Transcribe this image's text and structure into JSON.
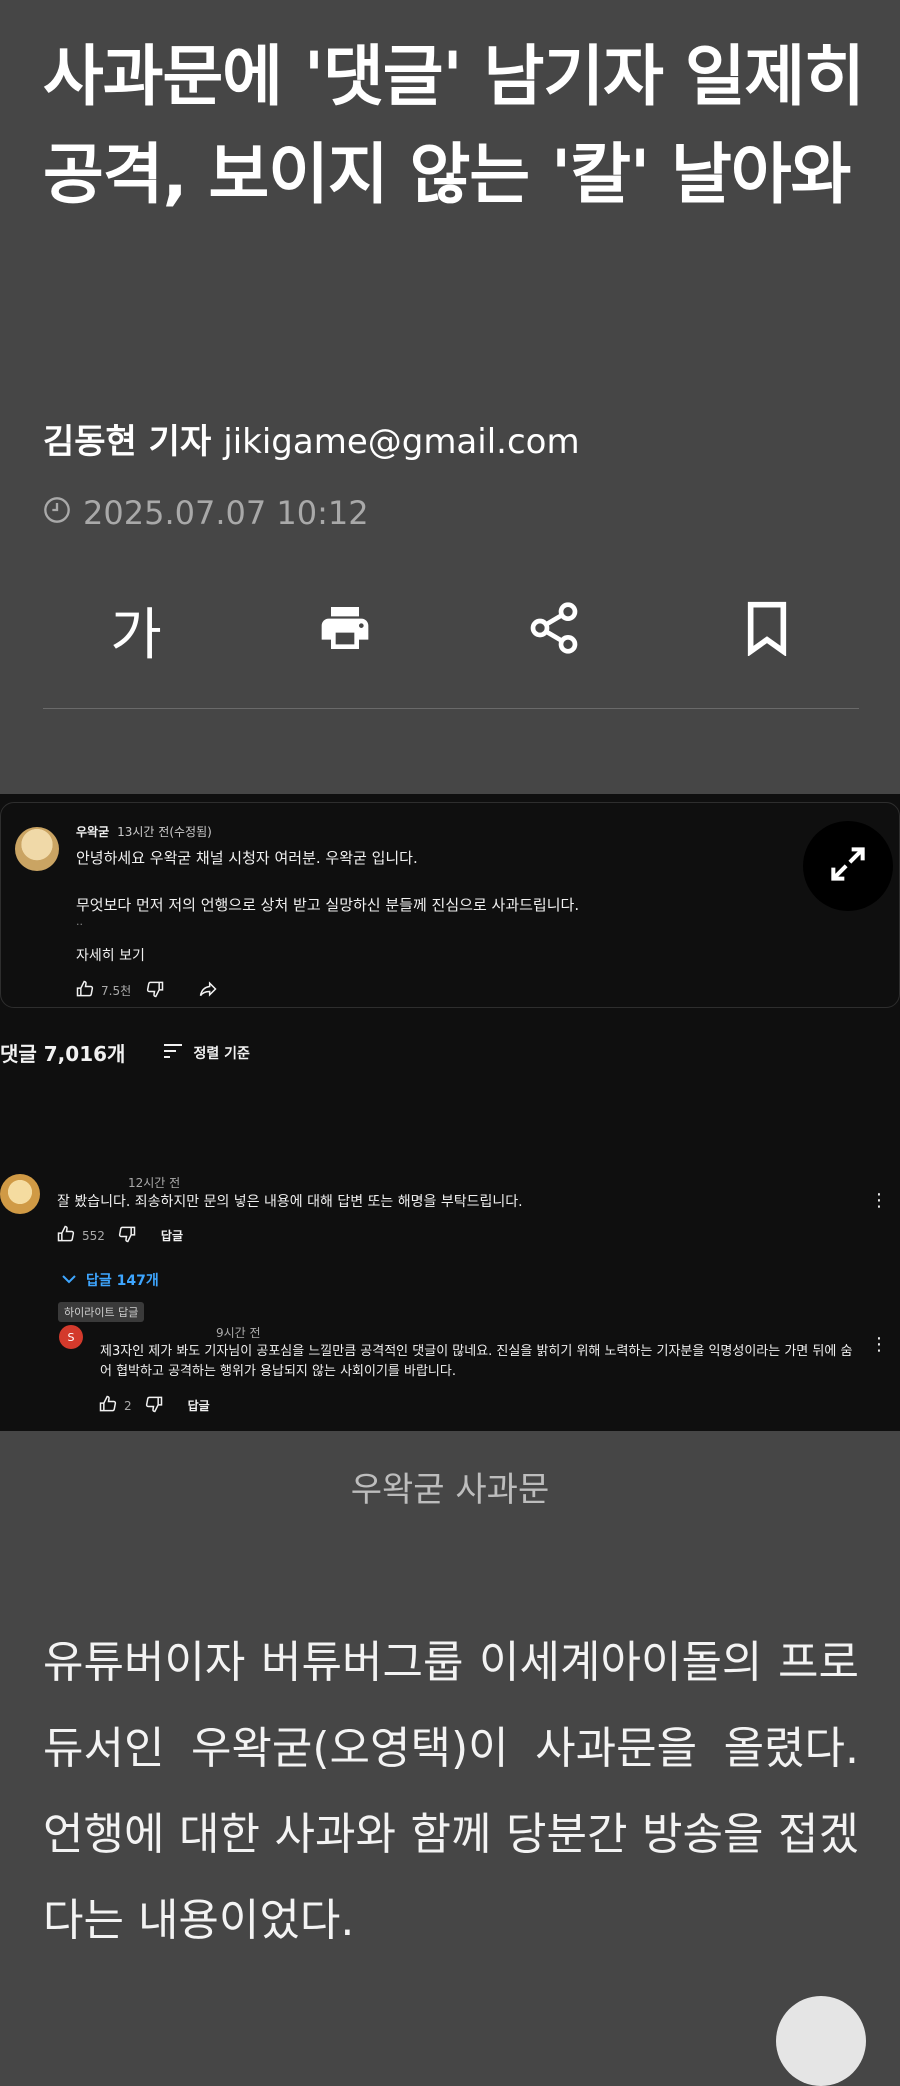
{
  "article": {
    "title": "사과문에 '댓글' 남기자 일제히 공격, 보이지 않는 '칼' 날아와",
    "author": "김동현 기자",
    "email": "jikigame@gmail.com",
    "date": "2025.07.07 10:12",
    "toolbar": {
      "font_label": "가",
      "print_icon": "print-icon",
      "share_icon": "share-icon",
      "bookmark_icon": "bookmark-icon"
    },
    "caption": "우왁굳 사과문",
    "body": "유튜버이자 버튜버그룹 이세계아이돌의 프로듀서인 우왁굳(오영택)이 사과문을 올렸다. 언행에 대한 사과와 함께 당분간 방송을 접겠다는 내용이었다."
  },
  "screenshot": {
    "post": {
      "author": "우왁굳",
      "time": "13시간 전(수정됨)",
      "line1": "안녕하세요 우왁굳 채널 시청자 여러분. 우왁굳 입니다.",
      "line2": "무엇보다 먼저 저의 언행으로 상처 받고 실망하신 분들께 진심으로 사과드립니다.",
      "ellipsis": "..",
      "more": "자세히 보기",
      "likes": "7.5천"
    },
    "comments_count": "댓글 7,016개",
    "sort_label": "정렬 기준",
    "comment1": {
      "time": "12시간 전",
      "text": "잘 봤습니다. 죄송하지만 문의 넣은 내용에 대해 답변 또는 해명을 부탁드립니다.",
      "likes": "552",
      "reply": "답글",
      "replies": "답글 147개",
      "highlight": "하이라이트 답글"
    },
    "reply1": {
      "avatar_letter": "S",
      "time": "9시간 전",
      "text": "제3자인 제가 봐도 기자님이 공포심을 느낄만큼 공격적인 댓글이 많네요. 진실을 밝히기 위해 노력하는 기자분을 익명성이라는 가면 뒤에 숨어 협박하고 공격하는 행위가 용납되지 않는 사회이기를 바랍니다.",
      "likes": "2",
      "reply": "답글"
    }
  },
  "colors": {
    "page_bg": "#464646",
    "screenshot_bg": "#0f0f0f",
    "link_blue": "#3ea6ff",
    "badge_red": "#d33a2c"
  }
}
